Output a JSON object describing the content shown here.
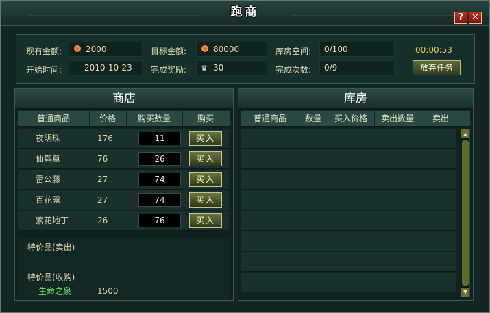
{
  "window": {
    "title": "跑商"
  },
  "top": {
    "current_gold_label": "现有金额:",
    "current_gold": "2000",
    "target_gold_label": "目标金额:",
    "target_gold": "80000",
    "warehouse_space_label": "库房空间:",
    "warehouse_space": "0/100",
    "timer": "00:00:53",
    "start_time_label": "开始时间:",
    "start_time": "2010-10-23",
    "reward_label": "完成奖励:",
    "reward": "30",
    "completions_label": "完成次数:",
    "completions": "0/9",
    "abandon_button": "放弃任务"
  },
  "shop": {
    "title": "商店",
    "headers": [
      "普通商品",
      "价格",
      "购买数量",
      "购买"
    ],
    "buy_label": "买入",
    "items": [
      {
        "name": "夜明珠",
        "price": "176",
        "qty": "11"
      },
      {
        "name": "仙鹤草",
        "price": "76",
        "qty": "26"
      },
      {
        "name": "雷公藤",
        "price": "27",
        "qty": "74"
      },
      {
        "name": "百花露",
        "price": "27",
        "qty": "74"
      },
      {
        "name": "紫花地丁",
        "price": "26",
        "qty": "76"
      }
    ],
    "special_sell_label": "特价品(卖出)",
    "special_buy_label": "特价品(收购)",
    "special_buy_item": "生命之泉",
    "special_buy_price": "1500"
  },
  "warehouse": {
    "title": "库房",
    "headers": [
      "普通商品",
      "数量",
      "买入价格",
      "卖出数量",
      "卖出"
    ]
  },
  "colors": {
    "accent_gold": "#f2c64a",
    "close_red": "#c22d1f",
    "green_text": "#5fe05f"
  }
}
